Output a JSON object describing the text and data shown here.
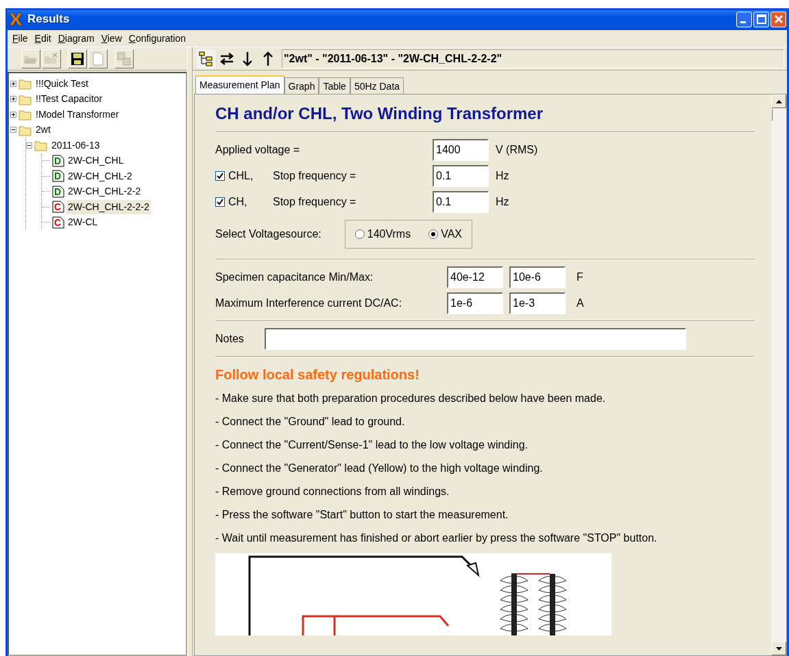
{
  "window": {
    "title": "Results"
  },
  "menu": [
    "File",
    "Edit",
    "Diagram",
    "View",
    "Configuration"
  ],
  "left_toolbar": [
    {
      "kind": "open",
      "disabled": true
    },
    {
      "kind": "close",
      "disabled": true
    },
    {
      "kind": "save",
      "disabled": false
    },
    {
      "kind": "new",
      "disabled": true
    },
    {
      "kind": "copy",
      "disabled": true
    }
  ],
  "tree": [
    {
      "label": "!!!Quick Test",
      "kind": "folder",
      "expanded": false,
      "selected": false
    },
    {
      "label": "!!Test Capacitor",
      "kind": "folder",
      "expanded": false,
      "selected": false
    },
    {
      "label": "!Model Transformer",
      "kind": "folder",
      "expanded": false,
      "selected": false
    },
    {
      "label": "2wt",
      "kind": "folder",
      "expanded": true,
      "selected": false,
      "children": [
        {
          "label": "2011-06-13",
          "kind": "folder",
          "expanded": true,
          "selected": false,
          "children": [
            {
              "label": "2W-CH_CHL",
              "kind": "document",
              "letter": "D",
              "color": "#008000",
              "selected": false
            },
            {
              "label": "2W-CH_CHL-2",
              "kind": "document",
              "letter": "D",
              "color": "#008000",
              "selected": false
            },
            {
              "label": "2W-CH_CHL-2-2",
              "kind": "document",
              "letter": "D",
              "color": "#008000",
              "selected": false
            },
            {
              "label": "2W-CH_CHL-2-2-2",
              "kind": "document",
              "letter": "C",
              "color": "#e00000",
              "selected": true
            },
            {
              "label": "2W-CL",
              "kind": "document",
              "letter": "C",
              "color": "#e00000",
              "selected": false
            }
          ]
        }
      ]
    }
  ],
  "right_toolbar": [
    {
      "kind": "tree",
      "pressed": true
    },
    {
      "kind": "swap",
      "pressed": false
    },
    {
      "kind": "down",
      "pressed": false
    },
    {
      "kind": "up",
      "pressed": false
    }
  ],
  "path": "\"2wt\" - \"2011-06-13\" - \"2W-CH_CHL-2-2-2\"",
  "tabs": [
    {
      "label": "Measurement Plan",
      "selected": true
    },
    {
      "label": "Graph",
      "selected": false
    },
    {
      "label": "Table",
      "selected": false
    },
    {
      "label": "50Hz Data",
      "selected": false
    }
  ],
  "form": {
    "title": "CH and/or CHL, Two Winding Transformer",
    "voltage": {
      "label": "Applied voltage =",
      "value": "1400",
      "unit": "V (RMS)"
    },
    "frequency_rows": [
      {
        "checked": true,
        "name": "CHL,",
        "label": "Stop frequency =",
        "value": "0.1",
        "unit": "Hz"
      },
      {
        "checked": true,
        "name": "CH,",
        "label": "Stop frequency =",
        "value": "0.1",
        "unit": "Hz"
      }
    ],
    "voltage_source": {
      "label": "Select Voltagesource:",
      "options": [
        {
          "label": "140Vrms",
          "selected": false
        },
        {
          "label": "VAX",
          "selected": true
        }
      ]
    },
    "limits": [
      {
        "label": "Specimen capacitance Min/Max:",
        "min": "40e-12",
        "max": "10e-6",
        "unit": "F"
      },
      {
        "label": "Maximum Interference current DC/AC:",
        "min": "1e-6",
        "max": "1e-3",
        "unit": "A"
      }
    ],
    "notes": {
      "label": "Notes"
    }
  },
  "safety": {
    "heading": "Follow local safety regulations!",
    "steps": [
      "- Make sure that both preparation procedures described below have been made.",
      "- Connect the \"Ground\" lead to ground.",
      "- Connect the \"Current/Sense-1\" lead to the low voltage winding.",
      "- Connect the \"Generator\" lead (Yellow) to the high voltage winding.",
      "- Remove ground connections from all windings.",
      "- Press the software \"Start\" button to start the measurement.",
      "- Wait until measurement has finished or abort earlier by press the software \"STOP\" button."
    ]
  }
}
